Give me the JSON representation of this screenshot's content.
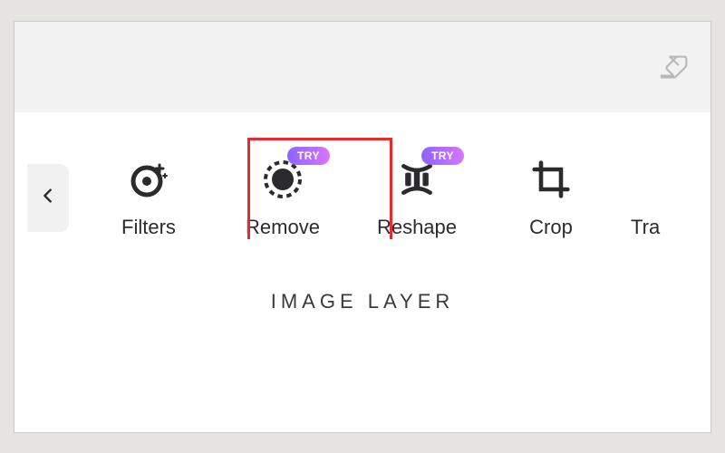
{
  "header": {
    "eraser_icon_name": "eraser-icon"
  },
  "toolbar": {
    "back_icon_name": "chevron-left-icon",
    "items": [
      {
        "label": "Filters",
        "name": "filters-tool",
        "try_badge": null
      },
      {
        "label": "Remove",
        "name": "remove-tool",
        "try_badge": "TRY"
      },
      {
        "label": "Reshape",
        "name": "reshape-tool",
        "try_badge": "TRY"
      },
      {
        "label": "Crop",
        "name": "crop-tool",
        "try_badge": null
      },
      {
        "label": "Tra",
        "name": "transform-tool-partial",
        "try_badge": null
      }
    ]
  },
  "section_title": "IMAGE LAYER",
  "highlight": {
    "target": "remove-tool"
  },
  "colors": {
    "badge_gradient_start": "#8b63ff",
    "badge_gradient_end": "#d876ff",
    "highlight_border": "#e82a2a",
    "icon": "#2b2b2e"
  }
}
